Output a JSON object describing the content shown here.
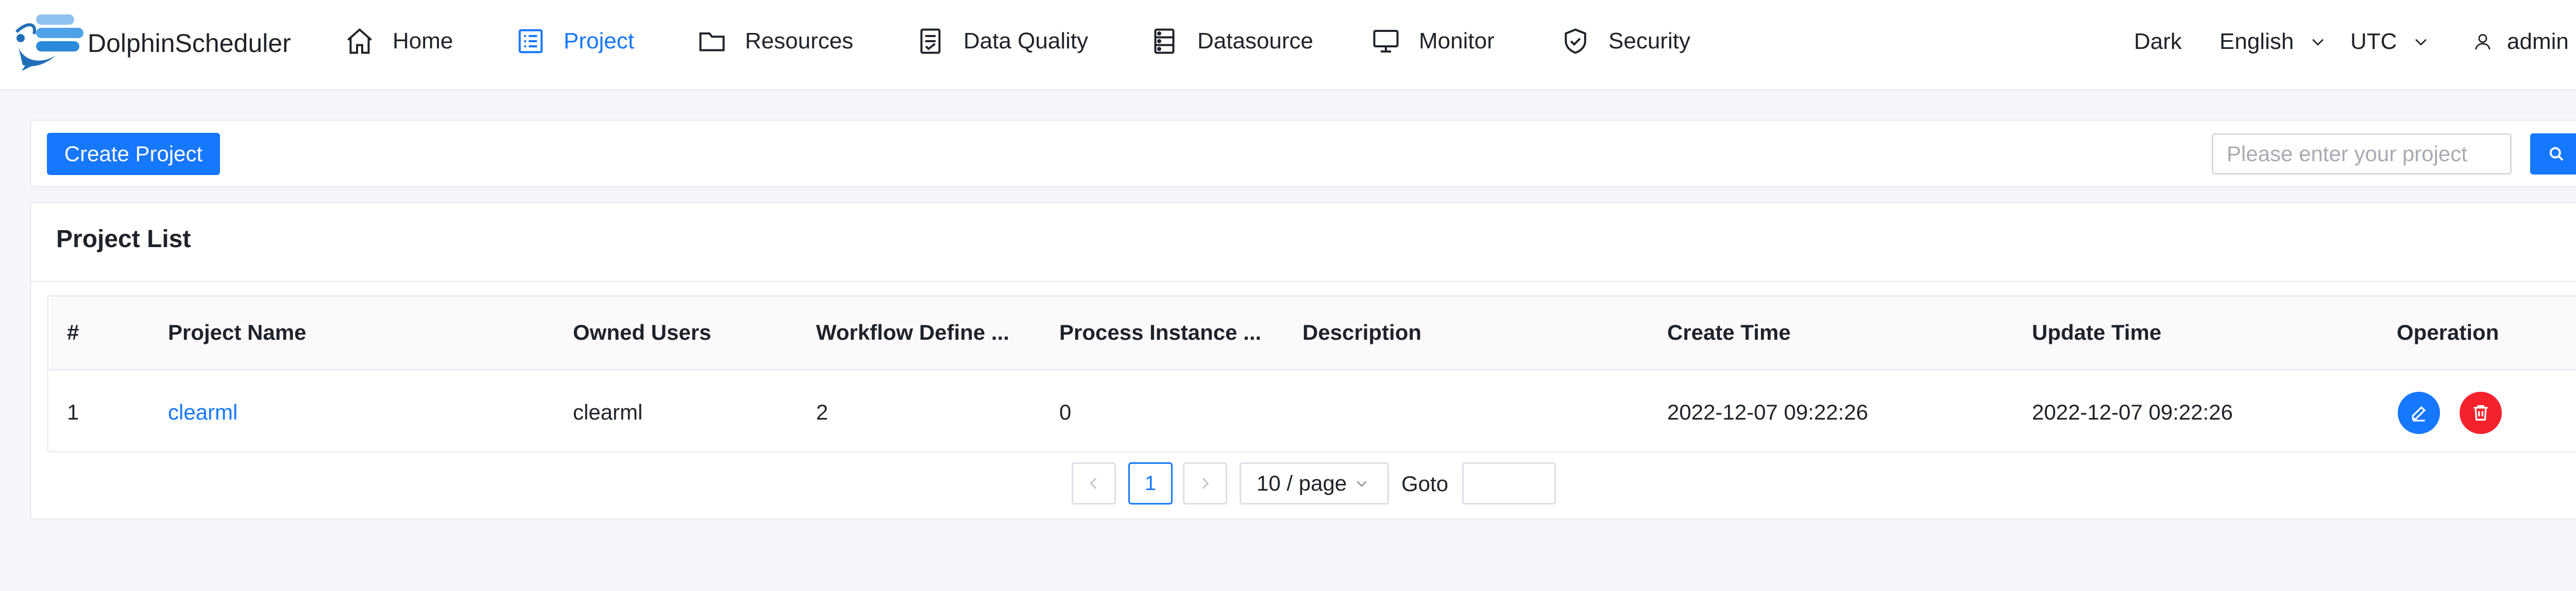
{
  "brand": {
    "name": "DolphinScheduler"
  },
  "nav": [
    {
      "label": "Home",
      "icon": "home-icon",
      "active": false
    },
    {
      "label": "Project",
      "icon": "project-icon",
      "active": true
    },
    {
      "label": "Resources",
      "icon": "folder-icon",
      "active": false
    },
    {
      "label": "Data Quality",
      "icon": "data-quality-icon",
      "active": false
    },
    {
      "label": "Datasource",
      "icon": "datasource-icon",
      "active": false
    },
    {
      "label": "Monitor",
      "icon": "monitor-icon",
      "active": false
    },
    {
      "label": "Security",
      "icon": "security-icon",
      "active": false
    }
  ],
  "header_right": {
    "theme": "Dark",
    "language": "English",
    "timezone": "UTC",
    "user": "admin"
  },
  "toolbar": {
    "create_label": "Create Project",
    "search_placeholder": "Please enter your project",
    "search_value": ""
  },
  "project_list": {
    "title": "Project List",
    "columns": [
      "#",
      "Project Name",
      "Owned Users",
      "Workflow Define ...",
      "Process Instance ...",
      "Description",
      "Create Time",
      "Update Time",
      "Operation"
    ],
    "rows": [
      {
        "index": "1",
        "name": "clearml",
        "owner": "clearml",
        "workflow_define_count": "2",
        "process_instance_count": "0",
        "description": "",
        "create_time": "2022-12-07 09:22:26",
        "update_time": "2022-12-07 09:22:26"
      }
    ]
  },
  "pagination": {
    "current_page": "1",
    "page_size": "10 / page",
    "goto_label": "Goto",
    "goto_value": ""
  },
  "colors": {
    "primary": "#1677ff",
    "danger": "#f5222d",
    "page_bg": "#f5f6f9",
    "text": "#1f2329"
  }
}
